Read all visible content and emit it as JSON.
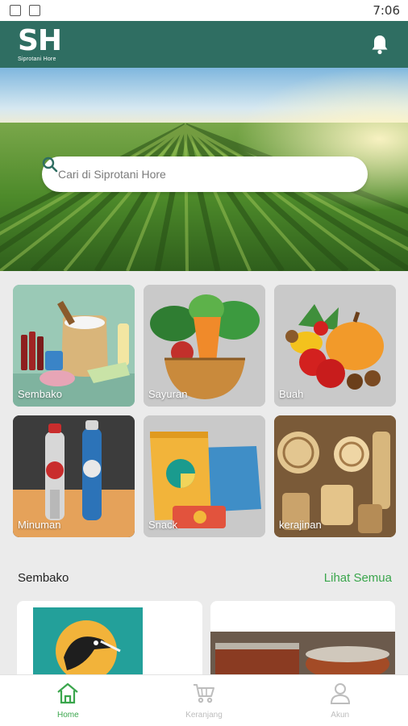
{
  "status_bar": {
    "time": "7:06",
    "icons": [
      "image-icon",
      "app-icon"
    ]
  },
  "app_bar": {
    "logo_mark": "SH",
    "logo_sub": "Siprotani Hore",
    "bell_icon": "bell-icon"
  },
  "search": {
    "placeholder": "Cari di Siprotani Hore",
    "icon": "search-icon"
  },
  "categories": [
    {
      "label": "Sembako"
    },
    {
      "label": "Sayuran"
    },
    {
      "label": "Buah"
    },
    {
      "label": "Minuman"
    },
    {
      "label": "Snack"
    },
    {
      "label": "kerajinan"
    }
  ],
  "section": {
    "title": "Sembako",
    "see_all": "Lihat Semua"
  },
  "bottom_nav": [
    {
      "label": "Home",
      "icon": "home-icon",
      "active": true
    },
    {
      "label": "Keranjang",
      "icon": "cart-icon",
      "active": false
    },
    {
      "label": "Akun",
      "icon": "user-icon",
      "active": false
    }
  ],
  "colors": {
    "primary": "#2f6e62",
    "accent": "#3aa64c",
    "inactive": "#bdbdbd"
  }
}
